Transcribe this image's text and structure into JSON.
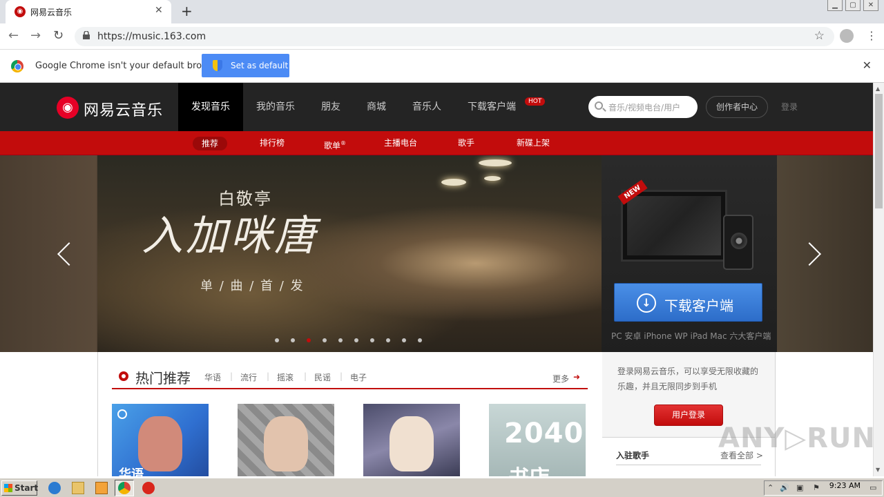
{
  "browser": {
    "tab_title": "网易云音乐",
    "new_tab": "+",
    "tab_close": "✕",
    "url": "https://music.163.com",
    "infobar_text": "Google Chrome isn't your default browser",
    "set_default_label": "Set as default",
    "infobar_close": "✕"
  },
  "site": {
    "logo_text": "网易云音乐",
    "nav": [
      "发现音乐",
      "我的音乐",
      "朋友",
      "商城",
      "音乐人",
      "下载客户端"
    ],
    "hot_badge": "HOT",
    "search_placeholder": "音乐/视频电台/用户",
    "creator_center": "创作者中心",
    "login": "登录",
    "subnav": [
      "推荐",
      "排行榜",
      "歌单",
      "主播电台",
      "歌手",
      "新碟上架"
    ],
    "subnav_sup": "®"
  },
  "banner": {
    "singer": "白敬亭",
    "song": "入加咪唐",
    "release": "单 / 曲 / 首 / 发",
    "dot_count": 10,
    "active_dot": 2,
    "new_badge": "NEW",
    "download_label": "下载客户端",
    "download_sub": "PC 安卓 iPhone WP iPad Mac 六大客户端"
  },
  "hot": {
    "title": "热门推荐",
    "tags": [
      "华语",
      "流行",
      "摇滚",
      "民谣",
      "电子"
    ],
    "more": "更多",
    "card1_label": "华语",
    "card4_line1": "2040",
    "card4_line2": "书店"
  },
  "sidebar": {
    "login_text": "登录网易云音乐，可以享受无限收藏的乐趣，并且无限同步到手机",
    "login_button": "用户登录",
    "singers_title": "入驻歌手",
    "singers_all": "查看全部 >"
  },
  "watermark": "ANY▷RUN",
  "taskbar": {
    "start": "Start",
    "clock": "9:23 AM"
  },
  "colors": {
    "brand_red": "#c20c0c",
    "nav_bg": "#242424",
    "download_blue": "#3a7ad8"
  }
}
